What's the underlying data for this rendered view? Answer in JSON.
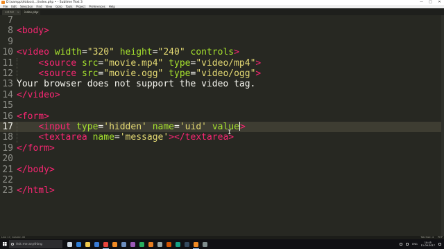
{
  "window": {
    "title": "D:\\xampp\\htdocs\\...\\index.php • - Sublime Text 3",
    "controls": [
      "—",
      "□",
      "✕"
    ]
  },
  "menu": [
    "File",
    "Edit",
    "Selection",
    "Find",
    "View",
    "Goto",
    "Tools",
    "Project",
    "Preferences",
    "Help"
  ],
  "tabs": [
    {
      "label": "cat.txt",
      "active": false
    },
    {
      "label": "index.php",
      "active": true
    }
  ],
  "editor": {
    "current_line": 17,
    "lines": [
      {
        "n": "7",
        "tokens": []
      },
      {
        "n": "8",
        "tokens": [
          [
            "t",
            "<"
          ],
          [
            "t",
            "body"
          ],
          [
            "t",
            ">"
          ]
        ]
      },
      {
        "n": "9",
        "tokens": []
      },
      {
        "n": "10",
        "tokens": [
          [
            "t",
            "<"
          ],
          [
            "t",
            "video"
          ],
          [
            "p",
            " "
          ],
          [
            "a",
            "width"
          ],
          [
            "p",
            "="
          ],
          [
            "s",
            "\"320\""
          ],
          [
            "p",
            " "
          ],
          [
            "a",
            "height"
          ],
          [
            "p",
            "="
          ],
          [
            "s",
            "\"240\""
          ],
          [
            "p",
            " "
          ],
          [
            "a",
            "controls"
          ],
          [
            "t",
            ">"
          ]
        ]
      },
      {
        "n": "11",
        "tokens": [
          [
            "p",
            "    "
          ],
          [
            "t",
            "<"
          ],
          [
            "t",
            "source"
          ],
          [
            "p",
            " "
          ],
          [
            "a",
            "src"
          ],
          [
            "p",
            "="
          ],
          [
            "s",
            "\"movie.mp4\""
          ],
          [
            "p",
            " "
          ],
          [
            "a",
            "type"
          ],
          [
            "p",
            "="
          ],
          [
            "s",
            "\"video/mp4\""
          ],
          [
            "t",
            ">"
          ]
        ]
      },
      {
        "n": "12",
        "tokens": [
          [
            "p",
            "    "
          ],
          [
            "t",
            "<"
          ],
          [
            "t",
            "source"
          ],
          [
            "p",
            " "
          ],
          [
            "a",
            "src"
          ],
          [
            "p",
            "="
          ],
          [
            "s",
            "\"movie.ogg\""
          ],
          [
            "p",
            " "
          ],
          [
            "a",
            "type"
          ],
          [
            "p",
            "="
          ],
          [
            "s",
            "\"video/ogg\""
          ],
          [
            "t",
            ">"
          ]
        ]
      },
      {
        "n": "13",
        "tokens": [
          [
            "p",
            "Your browser does not support the video tag."
          ]
        ]
      },
      {
        "n": "14",
        "tokens": [
          [
            "t",
            "</"
          ],
          [
            "t",
            "video"
          ],
          [
            "t",
            ">"
          ]
        ]
      },
      {
        "n": "15",
        "tokens": []
      },
      {
        "n": "16",
        "tokens": [
          [
            "t",
            "<"
          ],
          [
            "t",
            "form"
          ],
          [
            "t",
            ">"
          ]
        ]
      },
      {
        "n": "17",
        "tokens": [
          [
            "p",
            "    "
          ],
          [
            "t",
            "<"
          ],
          [
            "t",
            "input"
          ],
          [
            "p",
            " "
          ],
          [
            "a",
            "type"
          ],
          [
            "p",
            "="
          ],
          [
            "s",
            "'hidden'"
          ],
          [
            "p",
            " "
          ],
          [
            "a",
            "name"
          ],
          [
            "p",
            "="
          ],
          [
            "s",
            "'uid'"
          ],
          [
            "p",
            " "
          ],
          [
            "a",
            "value"
          ],
          [
            "c",
            ""
          ],
          [
            "t",
            ">"
          ]
        ]
      },
      {
        "n": "18",
        "tokens": [
          [
            "p",
            "    "
          ],
          [
            "t",
            "<"
          ],
          [
            "t",
            "textarea"
          ],
          [
            "p",
            " "
          ],
          [
            "a",
            "name"
          ],
          [
            "p",
            "="
          ],
          [
            "s",
            "'message'"
          ],
          [
            "t",
            ">"
          ],
          [
            "t",
            "</"
          ],
          [
            "t",
            "textarea"
          ],
          [
            "t",
            ">"
          ]
        ]
      },
      {
        "n": "19",
        "tokens": [
          [
            "t",
            "</"
          ],
          [
            "t",
            "form"
          ],
          [
            "t",
            ">"
          ]
        ]
      },
      {
        "n": "20",
        "tokens": []
      },
      {
        "n": "21",
        "tokens": [
          [
            "t",
            "</"
          ],
          [
            "t",
            "body"
          ],
          [
            "t",
            ">"
          ]
        ]
      },
      {
        "n": "22",
        "tokens": []
      },
      {
        "n": "23",
        "tokens": [
          [
            "t",
            "</"
          ],
          [
            "t",
            "html"
          ],
          [
            "t",
            ">"
          ]
        ]
      }
    ]
  },
  "status": {
    "left": "Line 17, Column 45",
    "tab_size": "Tab Size: 4",
    "syntax": "PHP"
  },
  "taskbar": {
    "search_placeholder": "Ask me anything",
    "apps": [
      {
        "name": "task-view",
        "color": "#cfd8e3",
        "active": false
      },
      {
        "name": "edge",
        "color": "#2f7ed8",
        "active": false
      },
      {
        "name": "file-explorer",
        "color": "#f2c94c",
        "active": false
      },
      {
        "name": "store",
        "color": "#3a7bd5",
        "active": false
      },
      {
        "name": "chrome",
        "color": "#e8453c",
        "active": true
      },
      {
        "name": "firefox",
        "color": "#f08a24",
        "active": false
      },
      {
        "name": "app-7",
        "color": "#6c8ebf",
        "active": false
      },
      {
        "name": "app-8",
        "color": "#9b59b6",
        "active": false
      },
      {
        "name": "app-9",
        "color": "#27ae60",
        "active": false
      },
      {
        "name": "app-10",
        "color": "#e67e22",
        "active": false
      },
      {
        "name": "app-11",
        "color": "#95a5a6",
        "active": false
      },
      {
        "name": "app-12",
        "color": "#d35400",
        "active": false
      },
      {
        "name": "app-13",
        "color": "#16a085",
        "active": false
      },
      {
        "name": "app-14",
        "color": "#34495e",
        "active": false
      },
      {
        "name": "sublime-text",
        "color": "#f08a24",
        "active": true
      },
      {
        "name": "app-16",
        "color": "#7f8c8d",
        "active": false
      }
    ],
    "tray_text": "ENG",
    "time": "10:45",
    "date": "11-09-2017"
  },
  "colors": {
    "background": "#272822",
    "tag": "#f92672",
    "attribute": "#a6e22e",
    "string": "#e6db74",
    "text": "#f8f8f2",
    "gutter": "#8f908a"
  }
}
